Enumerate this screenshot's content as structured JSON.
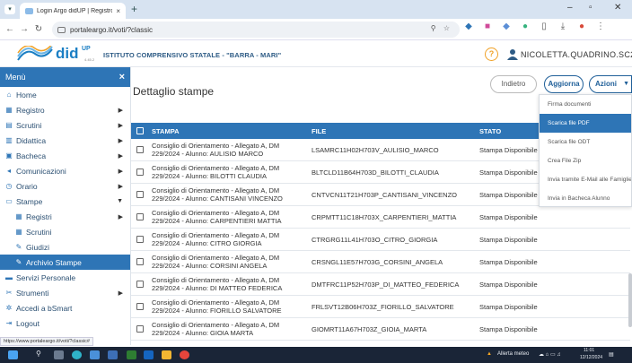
{
  "browser": {
    "tab_title": "Login Argo didUP | Registro Ele",
    "tab_close": "×",
    "new_tab": "+",
    "url": "portaleargo.it/voti/?classic",
    "win_minimize": "–",
    "win_maximize": "▫",
    "win_close": "✕"
  },
  "header": {
    "logo_text": "did",
    "logo_sup": "UP",
    "logo_version": "4.45.2",
    "school": "ISTITUTO COMPRENSIVO STATALE - \"BARRA - MARI\"",
    "help_label": "?",
    "user": "NICOLETTA.QUADRINO.SC29571"
  },
  "sidebar": {
    "title": "Menù",
    "close": "×",
    "items": [
      {
        "label": "Home",
        "icon": "home-icon",
        "glyph": "⌂"
      },
      {
        "label": "Registro",
        "icon": "calendar-icon",
        "glyph": "▦"
      },
      {
        "label": "Scrutini",
        "icon": "document-icon",
        "glyph": "▤"
      },
      {
        "label": "Didattica",
        "icon": "book-icon",
        "glyph": "▥"
      },
      {
        "label": "Bacheca",
        "icon": "board-icon",
        "glyph": "▣"
      },
      {
        "label": "Comunicazioni",
        "icon": "megaphone-icon",
        "glyph": "◂"
      },
      {
        "label": "Orario",
        "icon": "clock-icon",
        "glyph": "◷"
      },
      {
        "label": "Stampe",
        "icon": "printer-icon",
        "glyph": "▭"
      },
      {
        "label": "Registri",
        "icon": "calendar-icon",
        "glyph": "▦"
      },
      {
        "label": "Scrutini",
        "icon": "grid-icon",
        "glyph": "▦"
      },
      {
        "label": "Giudizi",
        "icon": "edit-icon",
        "glyph": "✎"
      },
      {
        "label": "Archivio Stampe",
        "icon": "edit-icon",
        "glyph": "✎"
      },
      {
        "label": "Servizi Personale",
        "icon": "folder-icon",
        "glyph": "▬"
      },
      {
        "label": "Strumenti",
        "icon": "tools-icon",
        "glyph": "✂"
      },
      {
        "label": "Accedi a bSmart",
        "icon": "sparkle-icon",
        "glyph": "✲"
      },
      {
        "label": "Logout",
        "icon": "logout-icon",
        "glyph": "⇥"
      }
    ]
  },
  "main": {
    "title": "Dettaglio stampe",
    "btn_back": "Indietro",
    "btn_refresh": "Aggiorna",
    "btn_actions": "Azioni",
    "columns": {
      "stampa": "STAMPA",
      "file": "FILE",
      "stato": "STATO"
    },
    "rows": [
      {
        "l1": "Consiglio di Orientamento - Allegato A, DM",
        "l2": "229/2024 - Alunno: AULISIO MARCO",
        "file": "LSAMRC11H02H703V_AULISIO_MARCO",
        "stato": "Stampa Disponibile"
      },
      {
        "l1": "Consiglio di Orientamento - Allegato A, DM",
        "l2": "229/2024 - Alunno: BILOTTI CLAUDIA",
        "file": "BLTCLD11B64H703D_BILOTTI_CLAUDIA",
        "stato": "Stampa Disponibile"
      },
      {
        "l1": "Consiglio di Orientamento - Allegato A, DM",
        "l2": "229/2024 - Alunno: CANTISANI VINCENZO",
        "file": "CNTVCN11T21H703P_CANTISANI_VINCENZO",
        "stato": "Stampa Disponibile"
      },
      {
        "l1": "Consiglio di Orientamento - Allegato A, DM",
        "l2": "229/2024 - Alunno: CARPENTIERI MATTIA",
        "file": "CRPMTT11C18H703X_CARPENTIERI_MATTIA",
        "stato": "Stampa Disponibile"
      },
      {
        "l1": "Consiglio di Orientamento - Allegato A, DM",
        "l2": "229/2024 - Alunno: CITRO GIORGIA",
        "file": "CTRGRG11L41H703O_CITRO_GIORGIA",
        "stato": "Stampa Disponibile"
      },
      {
        "l1": "Consiglio di Orientamento - Allegato A, DM",
        "l2": "229/2024 - Alunno: CORSINI ANGELA",
        "file": "CRSNGL11E57H703G_CORSINI_ANGELA",
        "stato": "Stampa Disponibile"
      },
      {
        "l1": "Consiglio di Orientamento - Allegato A, DM",
        "l2": "229/2024 - Alunno: DI MATTEO FEDERICA",
        "file": "DMTFRC11P52H703P_DI_MATTEO_FEDERICA",
        "stato": "Stampa Disponibile"
      },
      {
        "l1": "Consiglio di Orientamento - Allegato A, DM",
        "l2": "229/2024 - Alunno: FIORILLO SALVATORE",
        "file": "FRLSVT12B06H703Z_FIORILLO_SALVATORE",
        "stato": "Stampa Disponibile"
      },
      {
        "l1": "Consiglio di Orientamento - Allegato A, DM",
        "l2": "229/2024 - Alunno: GIOIA MARTA",
        "file": "GIOMRT11A67H703Z_GIOIA_MARTA",
        "stato": "Stampa Disponibile"
      }
    ]
  },
  "dropdown": {
    "items": [
      "Firma documenti",
      "Scarica file PDF",
      "Scarica file ODT",
      "Crea File Zip",
      "Invia tramite E-Mail alle Famiglie",
      "Invia in Bacheca Alunno"
    ]
  },
  "status_url": "https://www.portaleargo.it/voti/?classic#",
  "taskbar": {
    "weather": "Allerta meteo",
    "time": "11:01",
    "date": "12/12/2024"
  },
  "colors": {
    "accent": "#2e75b6",
    "brand": "#1b7fc4",
    "help": "#f0a126"
  }
}
